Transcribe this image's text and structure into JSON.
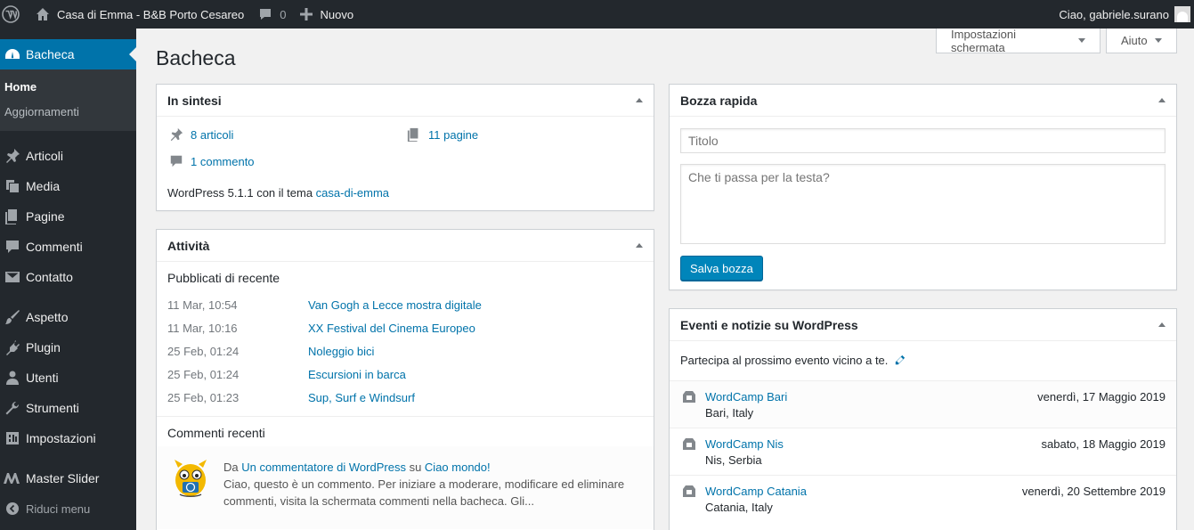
{
  "adminbar": {
    "site_name": "Casa di Emma - B&B Porto Cesareo",
    "comments_count": "0",
    "new_label": "Nuovo",
    "greeting": "Ciao, gabriele.surano"
  },
  "sidebar": {
    "current": "Bacheca",
    "submenu": [
      "Home",
      "Aggiornamenti"
    ],
    "items": [
      {
        "label": "Articoli",
        "icon": "pin-icon"
      },
      {
        "label": "Media",
        "icon": "media-icon"
      },
      {
        "label": "Pagine",
        "icon": "pages-icon"
      },
      {
        "label": "Commenti",
        "icon": "comment-icon"
      },
      {
        "label": "Contatto",
        "icon": "mail-icon"
      },
      {
        "label": "Aspetto",
        "icon": "brush-icon"
      },
      {
        "label": "Plugin",
        "icon": "plugin-icon"
      },
      {
        "label": "Utenti",
        "icon": "users-icon"
      },
      {
        "label": "Strumenti",
        "icon": "wrench-icon"
      },
      {
        "label": "Impostazioni",
        "icon": "settings-icon"
      },
      {
        "label": "Master Slider",
        "icon": "masterslider-icon"
      }
    ],
    "collapse": "Riduci menu"
  },
  "screen_options": "Impostazioni schermata",
  "help": "Aiuto",
  "page_title": "Bacheca",
  "glance": {
    "title": "In sintesi",
    "posts": "8 articoli",
    "pages": "11 pagine",
    "comments": "1 commento",
    "version_prefix": "WordPress 5.1.1 con il tema ",
    "theme": "casa-di-emma"
  },
  "activity": {
    "title": "Attività",
    "recent_heading": "Pubblicati di recente",
    "posts": [
      {
        "date": "11 Mar, 10:54",
        "title": "Van Gogh a Lecce mostra digitale"
      },
      {
        "date": "11 Mar, 10:16",
        "title": "XX Festival del Cinema Europeo"
      },
      {
        "date": "25 Feb, 01:24",
        "title": "Noleggio bici"
      },
      {
        "date": "25 Feb, 01:24",
        "title": "Escursioni in barca"
      },
      {
        "date": "25 Feb, 01:23",
        "title": "Sup, Surf e Windsurf"
      }
    ],
    "comments_heading": "Commenti recenti",
    "comment": {
      "from": "Da ",
      "author": "Un commentatore di WordPress",
      "on": " su ",
      "post": "Ciao mondo!",
      "text": "Ciao, questo è un commento. Per iniziare a moderare, modificare ed eliminare commenti, visita la schermata commenti nella bacheca. Gli..."
    }
  },
  "quick_draft": {
    "title": "Bozza rapida",
    "title_placeholder": "Titolo",
    "content_placeholder": "Che ti passa per la testa?",
    "save": "Salva bozza"
  },
  "events": {
    "title": "Eventi e notizie su WordPress",
    "intro": "Partecipa al prossimo evento vicino a te.",
    "items": [
      {
        "title": "WordCamp Bari",
        "location": "Bari, Italy",
        "date": "venerdì, 17 Maggio 2019"
      },
      {
        "title": "WordCamp Nis",
        "location": "Nis, Serbia",
        "date": "sabato, 18 Maggio 2019"
      },
      {
        "title": "WordCamp Catania",
        "location": "Catania, Italy",
        "date": "venerdì, 20 Settembre 2019"
      }
    ]
  },
  "colors": {
    "adminbar": "#23282d",
    "accent": "#0073aa",
    "button": "#0085ba",
    "background": "#f1f1f1"
  }
}
